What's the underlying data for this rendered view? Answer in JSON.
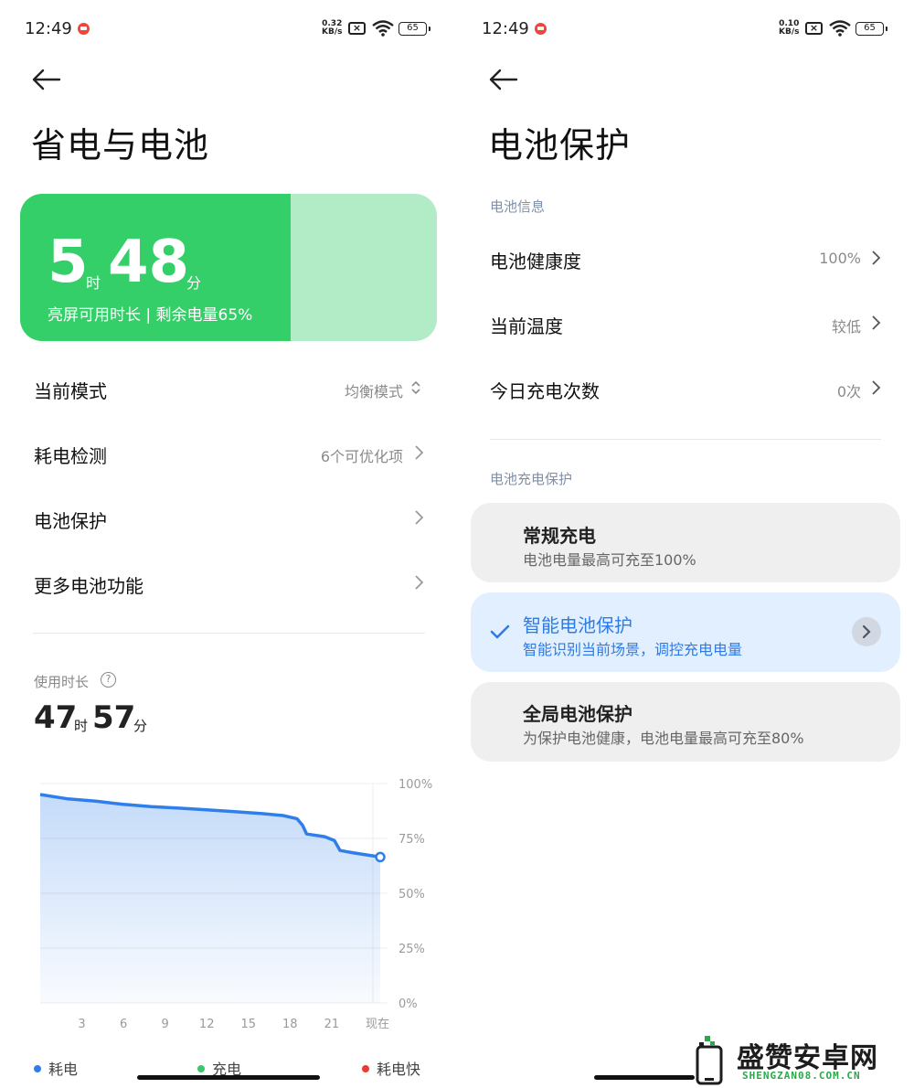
{
  "left": {
    "status": {
      "time": "12:49",
      "net_speed_value": "0.32",
      "net_speed_unit": "KB/s",
      "battery": "65"
    },
    "title": "省电与电池",
    "battery_card": {
      "hours": "5",
      "hours_unit": "时",
      "minutes": "48",
      "minutes_unit": "分",
      "subtitle": "亮屏可用时长 | 剩余电量65%",
      "level": 0.65,
      "fill_color": "#35cf69",
      "track_color": "#b2ecc6"
    },
    "rows": [
      {
        "label": "当前模式",
        "value": "均衡模式"
      },
      {
        "label": "耗电检测",
        "value": "6个可优化项"
      },
      {
        "label": "电池保护",
        "value": ""
      },
      {
        "label": "更多电池功能",
        "value": ""
      }
    ],
    "usage": {
      "label": "使用时长",
      "hours": "47",
      "hours_unit": "时",
      "minutes": "57",
      "minutes_unit": "分"
    },
    "legend": [
      {
        "label": "耗电",
        "color": "#2f7fea"
      },
      {
        "label": "充电",
        "color": "#3cc86a"
      },
      {
        "label": "耗电快",
        "color": "#ee3a2f"
      }
    ]
  },
  "right": {
    "status": {
      "time": "12:49",
      "net_speed_value": "0.10",
      "net_speed_unit": "KB/s",
      "battery": "65"
    },
    "title": "电池保护",
    "info_section": "电池信息",
    "info_rows": [
      {
        "label": "电池健康度",
        "value": "100%"
      },
      {
        "label": "当前温度",
        "value": "较低"
      },
      {
        "label": "今日充电次数",
        "value": "0次"
      }
    ],
    "charge_section": "电池充电保护",
    "options": [
      {
        "title": "常规充电",
        "desc": "电池电量最高可充至100%",
        "selected": false
      },
      {
        "title": "智能电池保护",
        "desc": "智能识别当前场景，调控充电电量",
        "selected": true
      },
      {
        "title": "全局电池保护",
        "desc": "为保护电池健康，电池电量最高可充至80%",
        "selected": false
      }
    ]
  },
  "watermark": {
    "main": "盛赞安卓网",
    "sub": "SHENGZAN08.COM.CN"
  },
  "chart_data": {
    "type": "area",
    "x_ticks": [
      "3",
      "6",
      "9",
      "12",
      "15",
      "18",
      "21",
      "现在"
    ],
    "y_ticks": [
      "100%",
      "75%",
      "50%",
      "25%",
      "0%"
    ],
    "ylim": [
      0,
      100
    ],
    "xlim": [
      0,
      24.5
    ],
    "series": [
      {
        "name": "耗电",
        "color": "#2f7fea",
        "points": [
          [
            0,
            95
          ],
          [
            2,
            93
          ],
          [
            4,
            92
          ],
          [
            6,
            90.5
          ],
          [
            8,
            89.5
          ],
          [
            10,
            88.8
          ],
          [
            12,
            88
          ],
          [
            14,
            87.2
          ],
          [
            16,
            86.3
          ],
          [
            17.5,
            85.4
          ],
          [
            18.5,
            84
          ],
          [
            18.9,
            81
          ],
          [
            19.2,
            77
          ],
          [
            20.5,
            75.8
          ],
          [
            21.2,
            74
          ],
          [
            21.6,
            69.5
          ],
          [
            22.5,
            68.5
          ],
          [
            24.5,
            66.5
          ]
        ]
      }
    ],
    "grid": true
  }
}
